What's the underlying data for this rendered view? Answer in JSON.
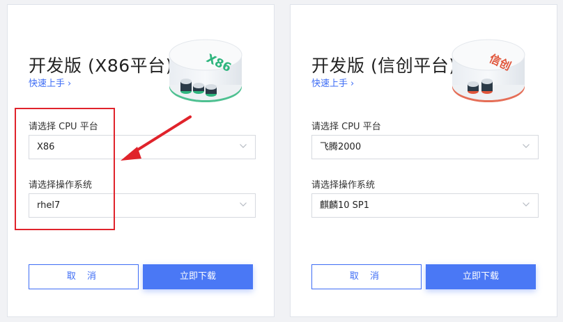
{
  "cards": [
    {
      "title": "开发版 (X86平台)",
      "quick_link": "快速上手",
      "badge_text": "X86",
      "badge_color": "#2fb57e",
      "cpu_label": "请选择 CPU 平台",
      "cpu_value": "X86",
      "os_label": "请选择操作系统",
      "os_value": "rhel7",
      "cancel_label": "取 消",
      "download_label": "立即下载"
    },
    {
      "title": "开发版 (信创平台)",
      "quick_link": "快速上手",
      "badge_text": "信创",
      "badge_color": "#e0553a",
      "cpu_label": "请选择 CPU 平台",
      "cpu_value": "飞腾2000",
      "os_label": "请选择操作系统",
      "os_value": "麒麟10 SP1",
      "cancel_label": "取 消",
      "download_label": "立即下载"
    }
  ],
  "colors": {
    "accent": "#3d6cf5",
    "primary_button": "#4a78f5",
    "annotation": "#e0232b"
  }
}
